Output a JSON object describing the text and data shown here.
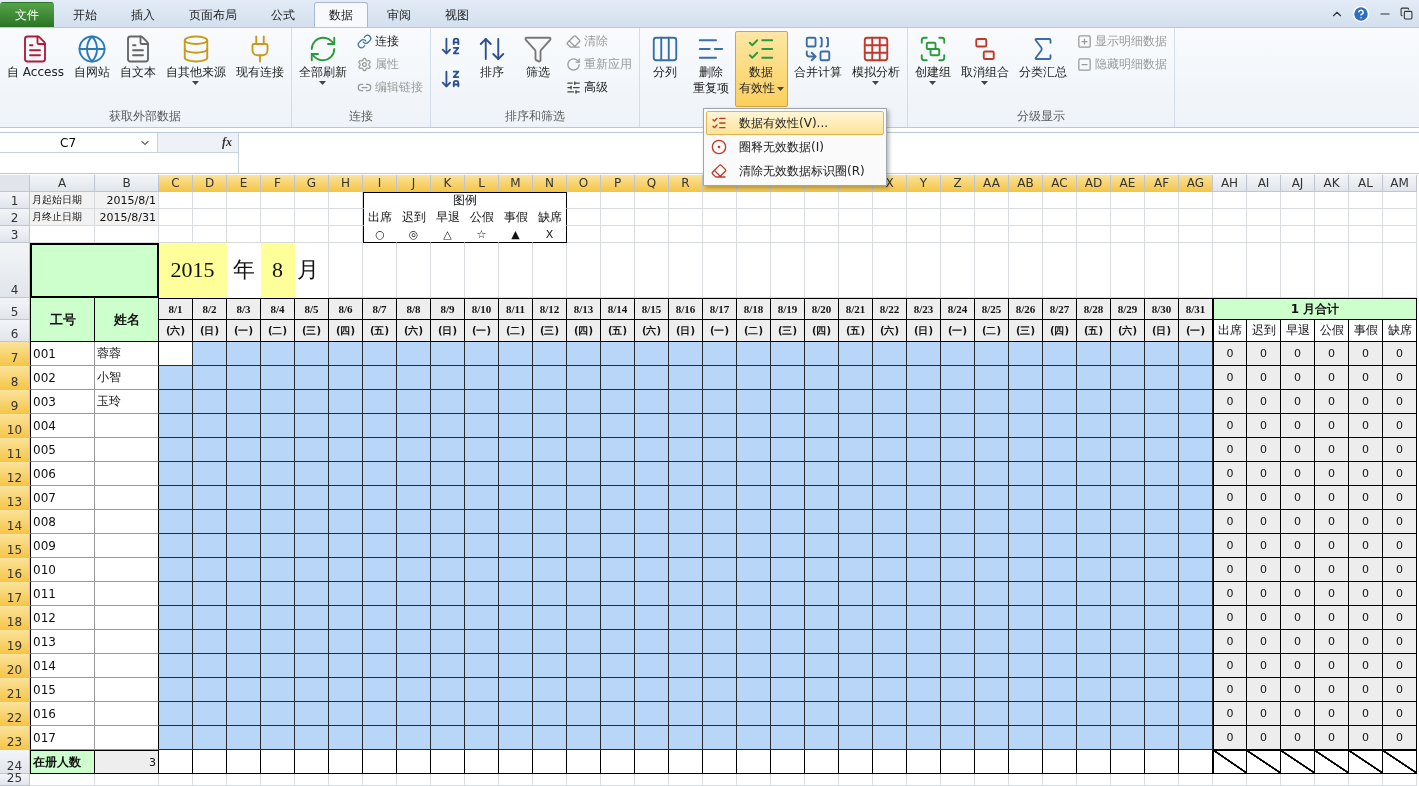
{
  "tabs": [
    {
      "label": "文件",
      "kind": "file",
      "selected": false
    },
    {
      "label": "开始",
      "kind": "tab",
      "selected": false
    },
    {
      "label": "插入",
      "kind": "tab",
      "selected": false
    },
    {
      "label": "页面布局",
      "kind": "tab",
      "selected": false
    },
    {
      "label": "公式",
      "kind": "tab",
      "selected": false
    },
    {
      "label": "数据",
      "kind": "tab",
      "selected": true
    },
    {
      "label": "审阅",
      "kind": "tab",
      "selected": false
    },
    {
      "label": "视图",
      "kind": "tab",
      "selected": false
    }
  ],
  "ribbon_groups": [
    {
      "label": "获取外部数据",
      "items": [
        {
          "kind": "large",
          "label": "自 Access"
        },
        {
          "kind": "large",
          "label": "自网站"
        },
        {
          "kind": "large",
          "label": "自文本"
        },
        {
          "kind": "large",
          "label": "自其他来源",
          "dropdown": true
        },
        {
          "kind": "large",
          "label": "现有连接"
        }
      ]
    },
    {
      "label": "连接",
      "items": [
        {
          "kind": "large",
          "label": "全部刷新",
          "dropdown": true
        },
        {
          "kind": "small",
          "label": "连接",
          "disabled": false
        },
        {
          "kind": "small",
          "label": "属性",
          "disabled": true
        },
        {
          "kind": "small",
          "label": "编辑链接",
          "disabled": true
        }
      ]
    },
    {
      "label": "排序和筛选",
      "items": [
        {
          "kind": "icon"
        },
        {
          "kind": "icon"
        },
        {
          "kind": "large",
          "label": "排序"
        },
        {
          "kind": "large",
          "label": "筛选"
        },
        {
          "kind": "small",
          "label": "清除",
          "disabled": true
        },
        {
          "kind": "small",
          "label": "重新应用",
          "disabled": true
        },
        {
          "kind": "small",
          "label": "高级",
          "disabled": false
        }
      ]
    },
    {
      "items": [
        {
          "kind": "large",
          "label": "分列",
          "pressed": false
        },
        {
          "kind": "large",
          "lines": [
            "删除",
            "重复项"
          ],
          "pressed": false
        },
        {
          "kind": "large",
          "lines": [
            "数据",
            "有效性"
          ],
          "dropdown": true,
          "pressed": true
        },
        {
          "kind": "large",
          "label": "合并计算",
          "pressed": false
        },
        {
          "kind": "large",
          "label": "模拟分析",
          "dropdown": true,
          "pressed": false
        }
      ]
    },
    {
      "label": "分级显示",
      "items": [
        {
          "kind": "large",
          "label": "创建组",
          "dropdown": true
        },
        {
          "kind": "large",
          "label": "取消组合",
          "dropdown": true
        },
        {
          "kind": "large",
          "label": "分类汇总"
        },
        {
          "kind": "small",
          "label": "显示明细数据",
          "disabled": true
        },
        {
          "kind": "small",
          "label": "隐藏明细数据",
          "disabled": true
        }
      ]
    }
  ],
  "menu": {
    "items": [
      {
        "label": "数据有效性(V)...",
        "selected": true
      },
      {
        "label": "圈释无效数据(I)",
        "selected": false
      },
      {
        "label": "清除无效数据标识圈(R)",
        "selected": false
      }
    ]
  },
  "formula_bar": {
    "name_box": "C7",
    "function_label": "fx"
  },
  "columns": [
    {
      "label": "A",
      "selected": false
    },
    {
      "label": "B",
      "selected": false
    },
    {
      "label": "C",
      "selected": true
    },
    {
      "label": "D",
      "selected": true
    },
    {
      "label": "E",
      "selected": true
    },
    {
      "label": "F",
      "selected": true
    },
    {
      "label": "G",
      "selected": true
    },
    {
      "label": "H",
      "selected": true
    },
    {
      "label": "I",
      "selected": true
    },
    {
      "label": "J",
      "selected": true
    },
    {
      "label": "K",
      "selected": true
    },
    {
      "label": "L",
      "selected": true
    },
    {
      "label": "M",
      "selected": true
    },
    {
      "label": "N",
      "selected": true
    },
    {
      "label": "O",
      "selected": true
    },
    {
      "label": "P",
      "selected": true
    },
    {
      "label": "Q",
      "selected": true
    },
    {
      "label": "R",
      "selected": true
    },
    {
      "selected": true
    },
    {
      "selected": true
    },
    {
      "selected": true
    },
    {
      "selected": true
    },
    {
      "selected": true
    },
    {
      "label": "X",
      "selected": true
    },
    {
      "label": "Y",
      "selected": true
    },
    {
      "label": "Z",
      "selected": true
    },
    {
      "label": "AA",
      "selected": true
    },
    {
      "label": "AB",
      "selected": true
    },
    {
      "label": "AC",
      "selected": true
    },
    {
      "label": "AD",
      "selected": true
    },
    {
      "label": "AE",
      "selected": true
    },
    {
      "label": "AF",
      "selected": true
    },
    {
      "label": "AG",
      "selected": true
    },
    {
      "label": "AH",
      "selected": false
    },
    {
      "label": "AI",
      "selected": false
    },
    {
      "label": "AJ",
      "selected": false
    },
    {
      "label": "AK",
      "selected": false
    },
    {
      "label": "AL",
      "selected": false
    },
    {
      "label": "AM",
      "selected": false
    }
  ],
  "rows": [
    {
      "label": "1",
      "selected": false
    },
    {
      "label": "2",
      "selected": false
    },
    {
      "label": "3",
      "selected": false
    },
    {
      "label": "4",
      "selected": false
    },
    {
      "label": "5",
      "selected": false
    },
    {
      "label": "6",
      "selected": false
    },
    {
      "label": "7",
      "selected": true
    },
    {
      "label": "8",
      "selected": true
    },
    {
      "label": "9",
      "selected": true
    },
    {
      "label": "10",
      "selected": true
    },
    {
      "label": "11",
      "selected": true
    },
    {
      "label": "12",
      "selected": true
    },
    {
      "label": "13",
      "selected": true
    },
    {
      "label": "14",
      "selected": true
    },
    {
      "label": "15",
      "selected": true
    },
    {
      "label": "16",
      "selected": true
    },
    {
      "label": "17",
      "selected": true
    },
    {
      "label": "18",
      "selected": true
    },
    {
      "label": "19",
      "selected": true
    },
    {
      "label": "20",
      "selected": true
    },
    {
      "label": "21",
      "selected": true
    },
    {
      "label": "22",
      "selected": true
    },
    {
      "label": "23",
      "selected": true
    },
    {
      "label": "24",
      "selected": false
    },
    {
      "label": "25",
      "selected": false
    }
  ],
  "info": [
    {
      "label": "月起始日期",
      "value": "2015/8/1"
    },
    {
      "label": "月终止日期",
      "value": "2015/8/31"
    }
  ],
  "legend": {
    "title": "图例",
    "items": [
      {
        "label": "出席",
        "symbol": "○"
      },
      {
        "label": "迟到",
        "symbol": "◎"
      },
      {
        "label": "早退",
        "symbol": "△"
      },
      {
        "label": "公假",
        "symbol": "☆"
      },
      {
        "label": "事假",
        "symbol": "▲"
      },
      {
        "label": "缺席",
        "symbol": "X"
      }
    ]
  },
  "period": {
    "year": "2015",
    "year_unit": "年",
    "month": "8",
    "month_unit": "月"
  },
  "headers": {
    "id": "工号",
    "name": "姓名",
    "summary_title": "1  月合计",
    "summary_columns": [
      "出席",
      "迟到",
      "早退",
      "公假",
      "事假",
      "缺席"
    ]
  },
  "days": [
    {
      "date": "8/1",
      "weekday": "(六)"
    },
    {
      "date": "8/2",
      "weekday": "(日)"
    },
    {
      "date": "8/3",
      "weekday": "(一)"
    },
    {
      "date": "8/4",
      "weekday": "(二)"
    },
    {
      "date": "8/5",
      "weekday": "(三)"
    },
    {
      "date": "8/6",
      "weekday": "(四)"
    },
    {
      "date": "8/7",
      "weekday": "(五)"
    },
    {
      "date": "8/8",
      "weekday": "(六)"
    },
    {
      "date": "8/9",
      "weekday": "(日)"
    },
    {
      "date": "8/10",
      "weekday": "(一)"
    },
    {
      "date": "8/11",
      "weekday": "(二)"
    },
    {
      "date": "8/12",
      "weekday": "(三)"
    },
    {
      "date": "8/13",
      "weekday": "(四)"
    },
    {
      "date": "8/14",
      "weekday": "(五)"
    },
    {
      "date": "8/15",
      "weekday": "(六)"
    },
    {
      "date": "8/16",
      "weekday": "(日)"
    },
    {
      "date": "8/17",
      "weekday": "(一)"
    },
    {
      "date": "8/18",
      "weekday": "(二)"
    },
    {
      "date": "8/19",
      "weekday": "(三)"
    },
    {
      "date": "8/20",
      "weekday": "(四)"
    },
    {
      "date": "8/21",
      "weekday": "(五)"
    },
    {
      "date": "8/22",
      "weekday": "(六)"
    },
    {
      "date": "8/23",
      "weekday": "(日)"
    },
    {
      "date": "8/24",
      "weekday": "(一)"
    },
    {
      "date": "8/25",
      "weekday": "(二)"
    },
    {
      "date": "8/26",
      "weekday": "(三)"
    },
    {
      "date": "8/27",
      "weekday": "(四)"
    },
    {
      "date": "8/28",
      "weekday": "(五)"
    },
    {
      "date": "8/29",
      "weekday": "(六)"
    },
    {
      "date": "8/30",
      "weekday": "(日)"
    },
    {
      "date": "8/31",
      "weekday": "(一)"
    }
  ],
  "employees": [
    {
      "id": "001",
      "name": "蓉蓉",
      "cursor": true,
      "totals": [
        "0",
        "0",
        "0",
        "0",
        "0",
        "0"
      ]
    },
    {
      "id": "002",
      "name": "小智",
      "cursor": false,
      "totals": [
        "0",
        "0",
        "0",
        "0",
        "0",
        "0"
      ]
    },
    {
      "id": "003",
      "name": "玉玲",
      "cursor": false,
      "totals": [
        "0",
        "0",
        "0",
        "0",
        "0",
        "0"
      ]
    },
    {
      "id": "004",
      "cursor": false,
      "totals": [
        "0",
        "0",
        "0",
        "0",
        "0",
        "0"
      ]
    },
    {
      "id": "005",
      "cursor": false,
      "totals": [
        "0",
        "0",
        "0",
        "0",
        "0",
        "0"
      ]
    },
    {
      "id": "006",
      "cursor": false,
      "totals": [
        "0",
        "0",
        "0",
        "0",
        "0",
        "0"
      ]
    },
    {
      "id": "007",
      "cursor": false,
      "totals": [
        "0",
        "0",
        "0",
        "0",
        "0",
        "0"
      ]
    },
    {
      "id": "008",
      "cursor": false,
      "totals": [
        "0",
        "0",
        "0",
        "0",
        "0",
        "0"
      ]
    },
    {
      "id": "009",
      "cursor": false,
      "totals": [
        "0",
        "0",
        "0",
        "0",
        "0",
        "0"
      ]
    },
    {
      "id": "010",
      "cursor": false,
      "totals": [
        "0",
        "0",
        "0",
        "0",
        "0",
        "0"
      ]
    },
    {
      "id": "011",
      "cursor": false,
      "totals": [
        "0",
        "0",
        "0",
        "0",
        "0",
        "0"
      ]
    },
    {
      "id": "012",
      "cursor": false,
      "totals": [
        "0",
        "0",
        "0",
        "0",
        "0",
        "0"
      ]
    },
    {
      "id": "013",
      "cursor": false,
      "totals": [
        "0",
        "0",
        "0",
        "0",
        "0",
        "0"
      ]
    },
    {
      "id": "014",
      "cursor": false,
      "totals": [
        "0",
        "0",
        "0",
        "0",
        "0",
        "0"
      ]
    },
    {
      "id": "015",
      "cursor": false,
      "totals": [
        "0",
        "0",
        "0",
        "0",
        "0",
        "0"
      ]
    },
    {
      "id": "016",
      "cursor": false,
      "totals": [
        "0",
        "0",
        "0",
        "0",
        "0",
        "0"
      ]
    },
    {
      "id": "017",
      "cursor": false,
      "totals": [
        "0",
        "0",
        "0",
        "0",
        "0",
        "0"
      ]
    }
  ],
  "footer": {
    "label": "在册人数",
    "count": "3"
  }
}
